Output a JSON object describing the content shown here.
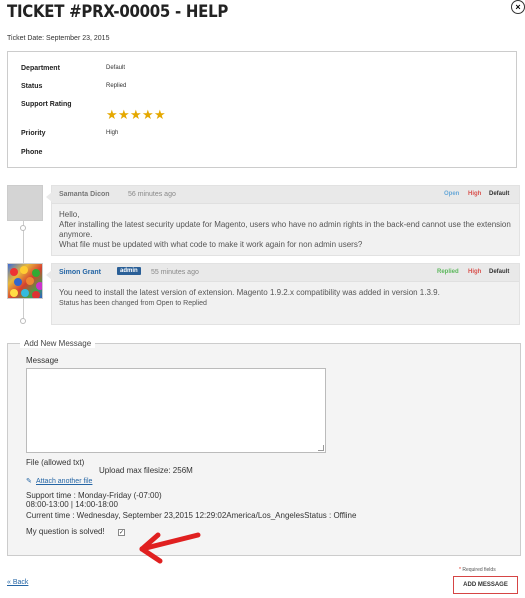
{
  "header": {
    "title": "TICKET #PRX-00005 - HELP",
    "close_symbol": "×"
  },
  "ticket_date": "Ticket Date: September 23, 2015",
  "info": {
    "department_label": "Department",
    "department_value": "Default",
    "status_label": "Status",
    "status_value": "Replied",
    "rating_label": "Support Rating",
    "rating_value": 5,
    "priority_label": "Priority",
    "priority_value": "High",
    "phone_label": "Phone",
    "phone_value": ""
  },
  "messages": [
    {
      "author": "Samanta Dicon",
      "time": "56 minutes ago",
      "tags": [
        {
          "label": "Open",
          "color": "#6aa9d8"
        },
        {
          "label": "High",
          "color": "#d9534f"
        },
        {
          "label": "Default",
          "color": "#333333"
        }
      ],
      "lines": [
        "Hello,",
        "After installing the latest security update for Magento, users who have no admin rights in the back-end cannot use the extension anymore.",
        "What file must be updated with what code to make it work again for non admin users?"
      ]
    },
    {
      "author": "Simon Grant",
      "badge": "admin",
      "time": "55 minutes ago",
      "tags": [
        {
          "label": "Replied",
          "color": "#5cb85c"
        },
        {
          "label": "High",
          "color": "#d9534f"
        },
        {
          "label": "Default",
          "color": "#333333"
        }
      ],
      "lines": [
        "You need to install the latest version of extension. Magento 1.9.2.x compatibility was added in version 1.3.9."
      ],
      "status_note": "Status has been changed from Open to Replied"
    }
  ],
  "form": {
    "legend": "Add New Message",
    "message_label": "Message",
    "file_label": "File (allowed txt)",
    "upload_max": "Upload max filesize: 256M",
    "attach_link": "Attach another file",
    "support_time": "Support time : Monday-Friday (-07:00)",
    "support_hours": "08:00-13:00 | 14:00-18:00",
    "current_time": "Current time : Wednesday, September 23,2015 12:29:02America/Los_AngelesStatus : Offline",
    "solved_label": "My question is solved!",
    "solved_checked": true
  },
  "footer": {
    "required_text": "Required fields",
    "required_star": "*",
    "add_button": "ADD MESSAGE",
    "back_link": "« Back"
  },
  "colors": {
    "accent_blue": "#2465a5",
    "star": "#e5a800",
    "arrow_red": "#e02020",
    "button_border": "#d64545"
  }
}
